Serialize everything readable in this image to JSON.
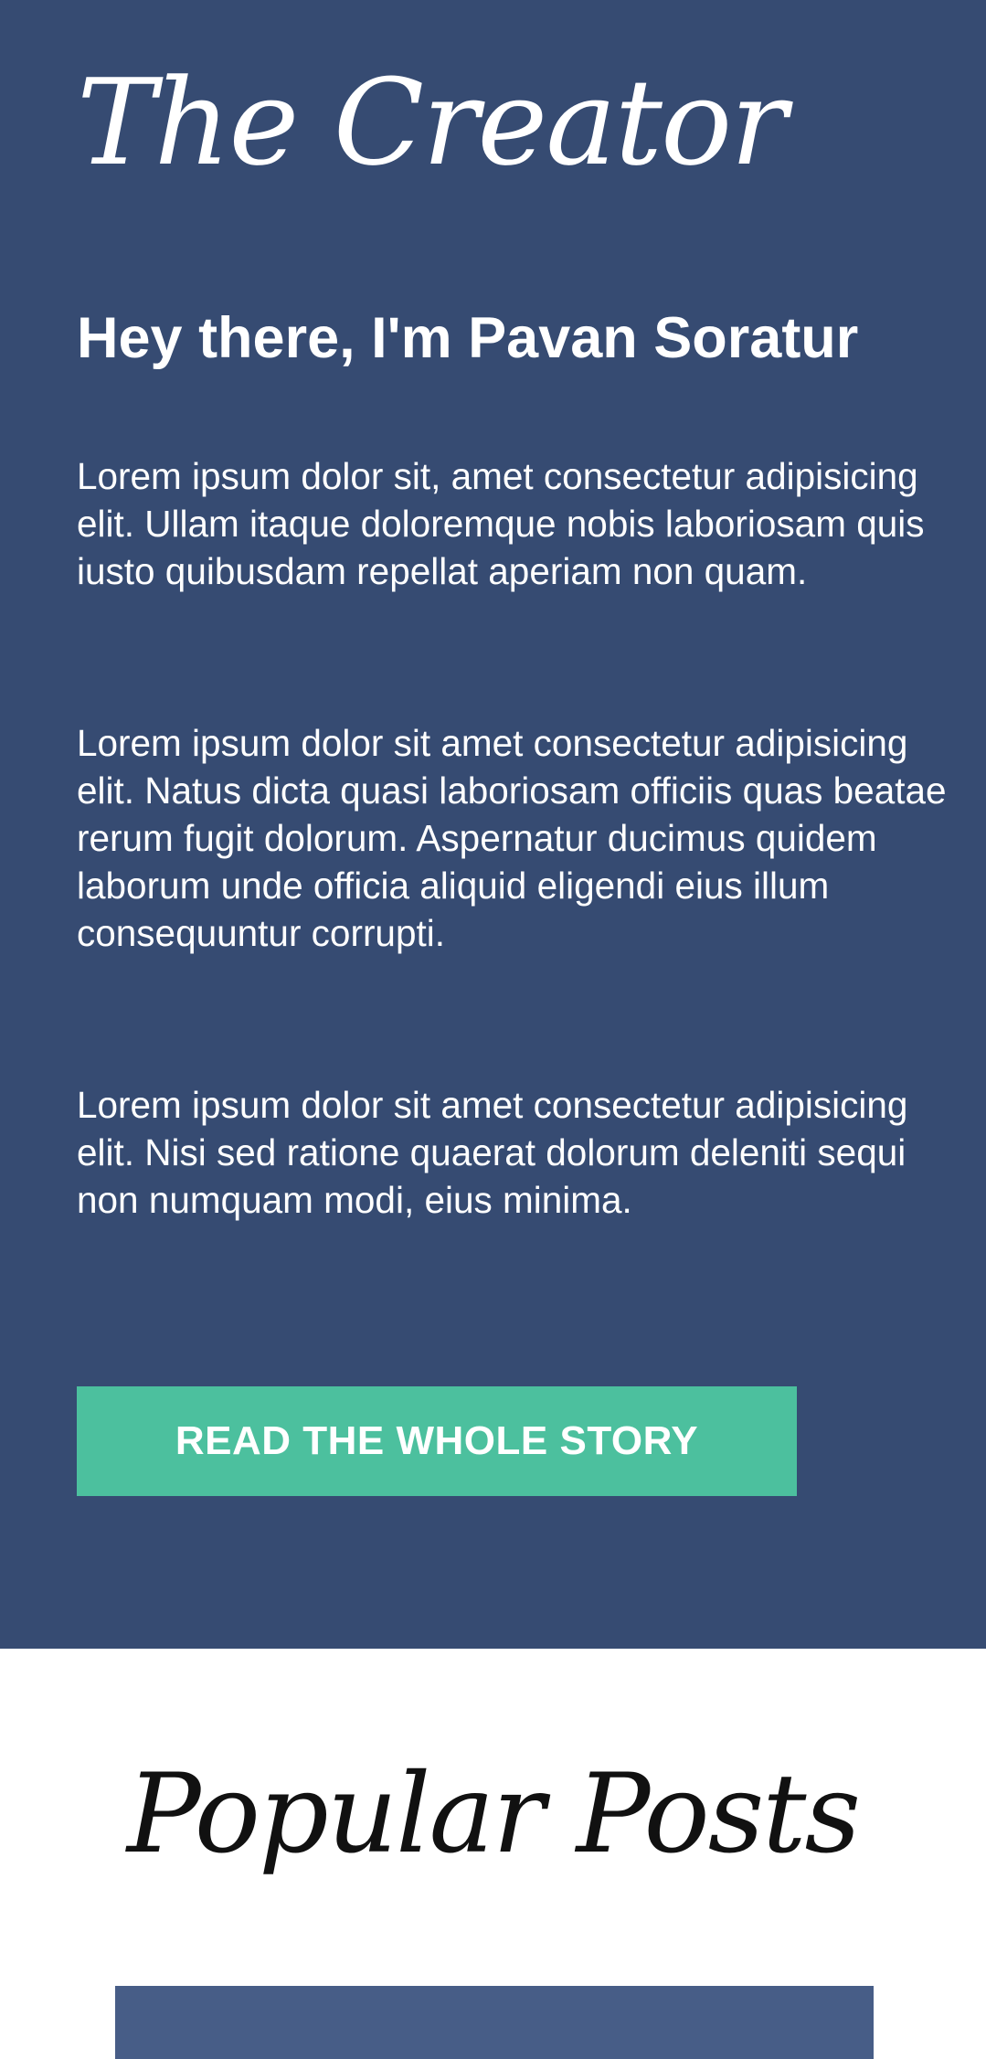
{
  "creator": {
    "title": "The Creator",
    "greeting": "Hey there, I'm Pavan Soratur",
    "paragraphs": [
      "Lorem ipsum dolor sit, amet consectetur adipisicing elit. Ullam itaque doloremque nobis laboriosam quis iusto quibusdam repellat aperiam non quam.",
      "Lorem ipsum dolor sit amet consectetur adipisicing elit. Natus dicta quasi laboriosam officiis quas beatae rerum fugit dolorum. Aspernatur ducimus quidem laborum unde officia aliquid eligendi eius illum consequuntur corrupti.",
      "Lorem ipsum dolor sit amet consectetur adipisicing elit. Nisi sed ratione quaerat dolorum deleniti sequi non numquam modi, eius minima."
    ],
    "button_label": "READ THE WHOLE STORY"
  },
  "popular": {
    "title": "Popular Posts"
  },
  "colors": {
    "creator_background": "#364b72",
    "button_background": "#4cc09e",
    "post_card_background": "#475d87"
  }
}
